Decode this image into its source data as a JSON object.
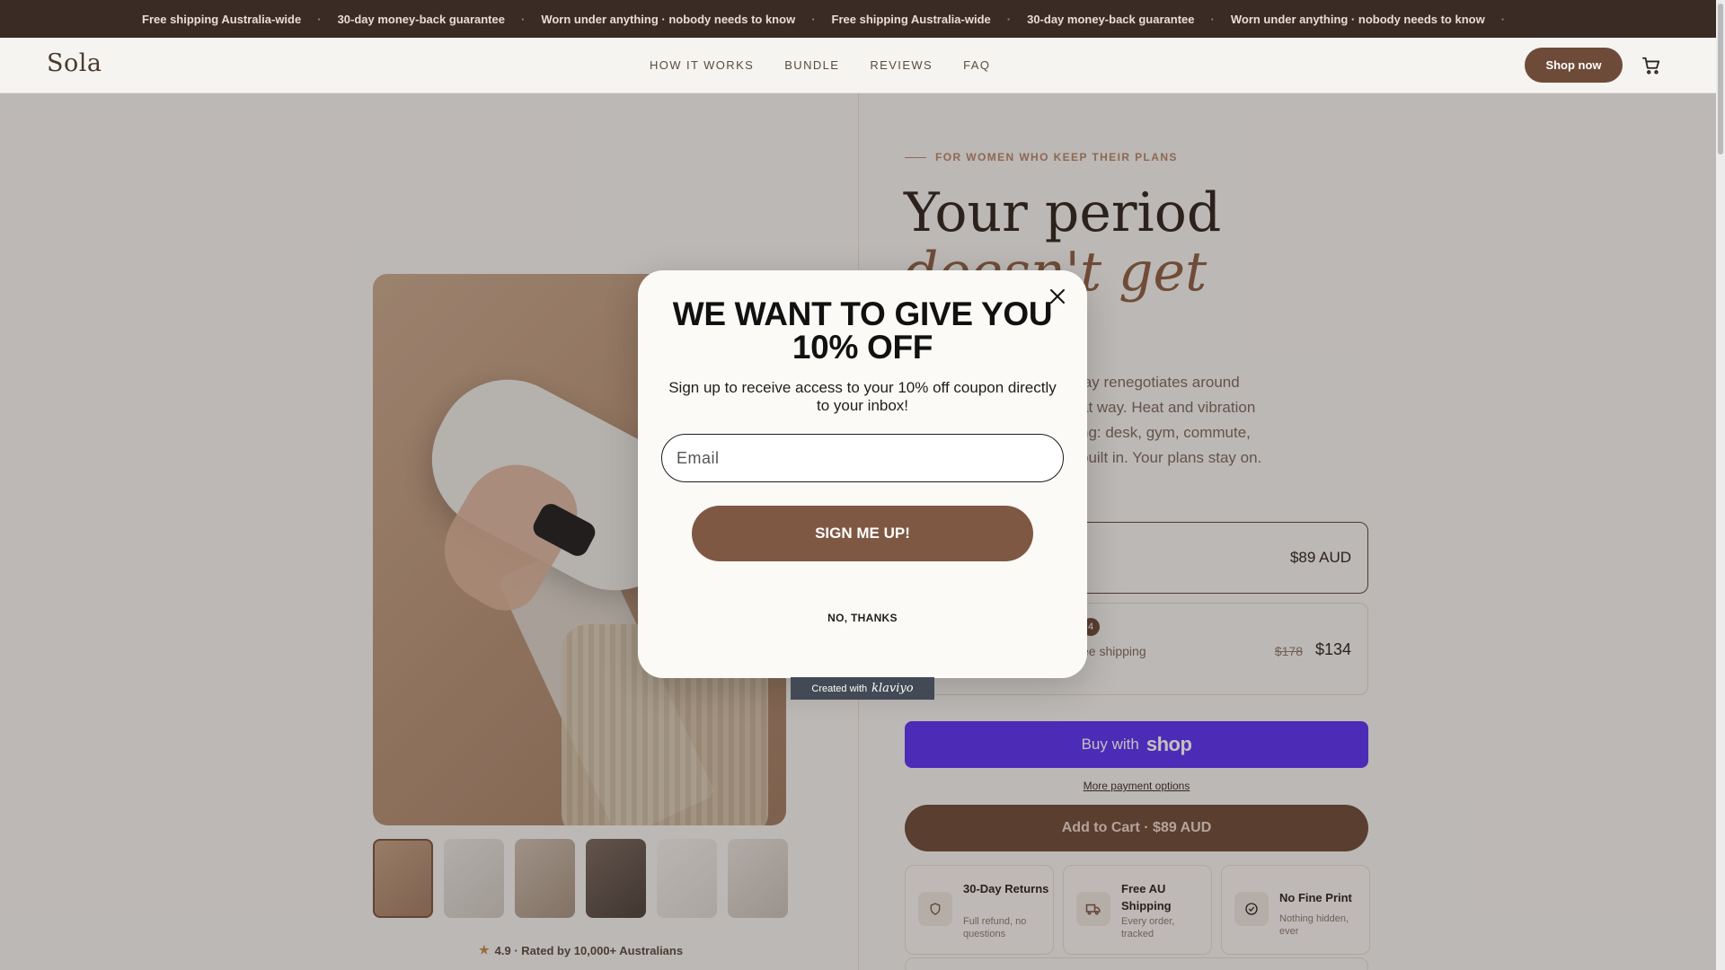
{
  "announcement": {
    "items": [
      "Free shipping Australia-wide",
      "30-day money-back guarantee",
      "Worn under anything · nobody needs to know",
      "Free shipping Australia-wide",
      "30-day money-back guarantee",
      "Worn under anything · nobody needs to know"
    ],
    "separator": "·"
  },
  "header": {
    "logo": "Sola",
    "nav": [
      "HOW IT WORKS",
      "BUNDLE",
      "REVIEWS",
      "FAQ"
    ],
    "shop_now_label": "Shop now",
    "cart_icon": "cart-icon"
  },
  "product": {
    "rating_text": "4.9 · Rated by 10,000+ Australians",
    "rating_icon": "star-icon"
  },
  "hero": {
    "eyebrow": "FOR WOMEN WHO KEEP THEIR PLANS",
    "title_line1": "Your period",
    "title_line2": "doesn't get",
    "description_lines": [
      "lay renegotiates around",
      "at way. Heat and vibration",
      "ng: desk, gym, commute,",
      "built in. Your plans stay on."
    ]
  },
  "options": {
    "single_price": "$89 AUD",
    "bundle_badge": "4",
    "bundle_sub": "ee shipping",
    "bundle_old_price": "$178",
    "bundle_new_price": "$134"
  },
  "purchase": {
    "buy_with": "Buy with",
    "shop_logo": "shop",
    "more_payment": "More payment options",
    "add_to_cart": "Add to Cart · $89 AUD"
  },
  "features": [
    {
      "icon": "shield-icon",
      "title": "30-Day Returns",
      "sub": "Full refund, no questions"
    },
    {
      "icon": "truck-icon",
      "title": "Free AU Shipping",
      "sub": "Every order, tracked"
    },
    {
      "icon": "check-circle-icon",
      "title": "No Fine Print",
      "sub": "Nothing hidden, ever"
    }
  ],
  "popup": {
    "title": "WE WANT TO GIVE YOU 10% OFF",
    "subtitle": "Sign up to receive access to your 10% off coupon directly to your inbox!",
    "email_placeholder": "Email",
    "signup_label": "SIGN ME UP!",
    "no_thanks_label": "NO, THANKS",
    "close_icon": "close-icon",
    "badge_prefix": "Created with",
    "badge_brand": "klaviyo"
  },
  "colors": {
    "announcement_bg": "#3a2c24",
    "brand_brown": "#6e4b39",
    "shop_purple": "#5a31f4",
    "accent_italic": "#8c5f45"
  }
}
